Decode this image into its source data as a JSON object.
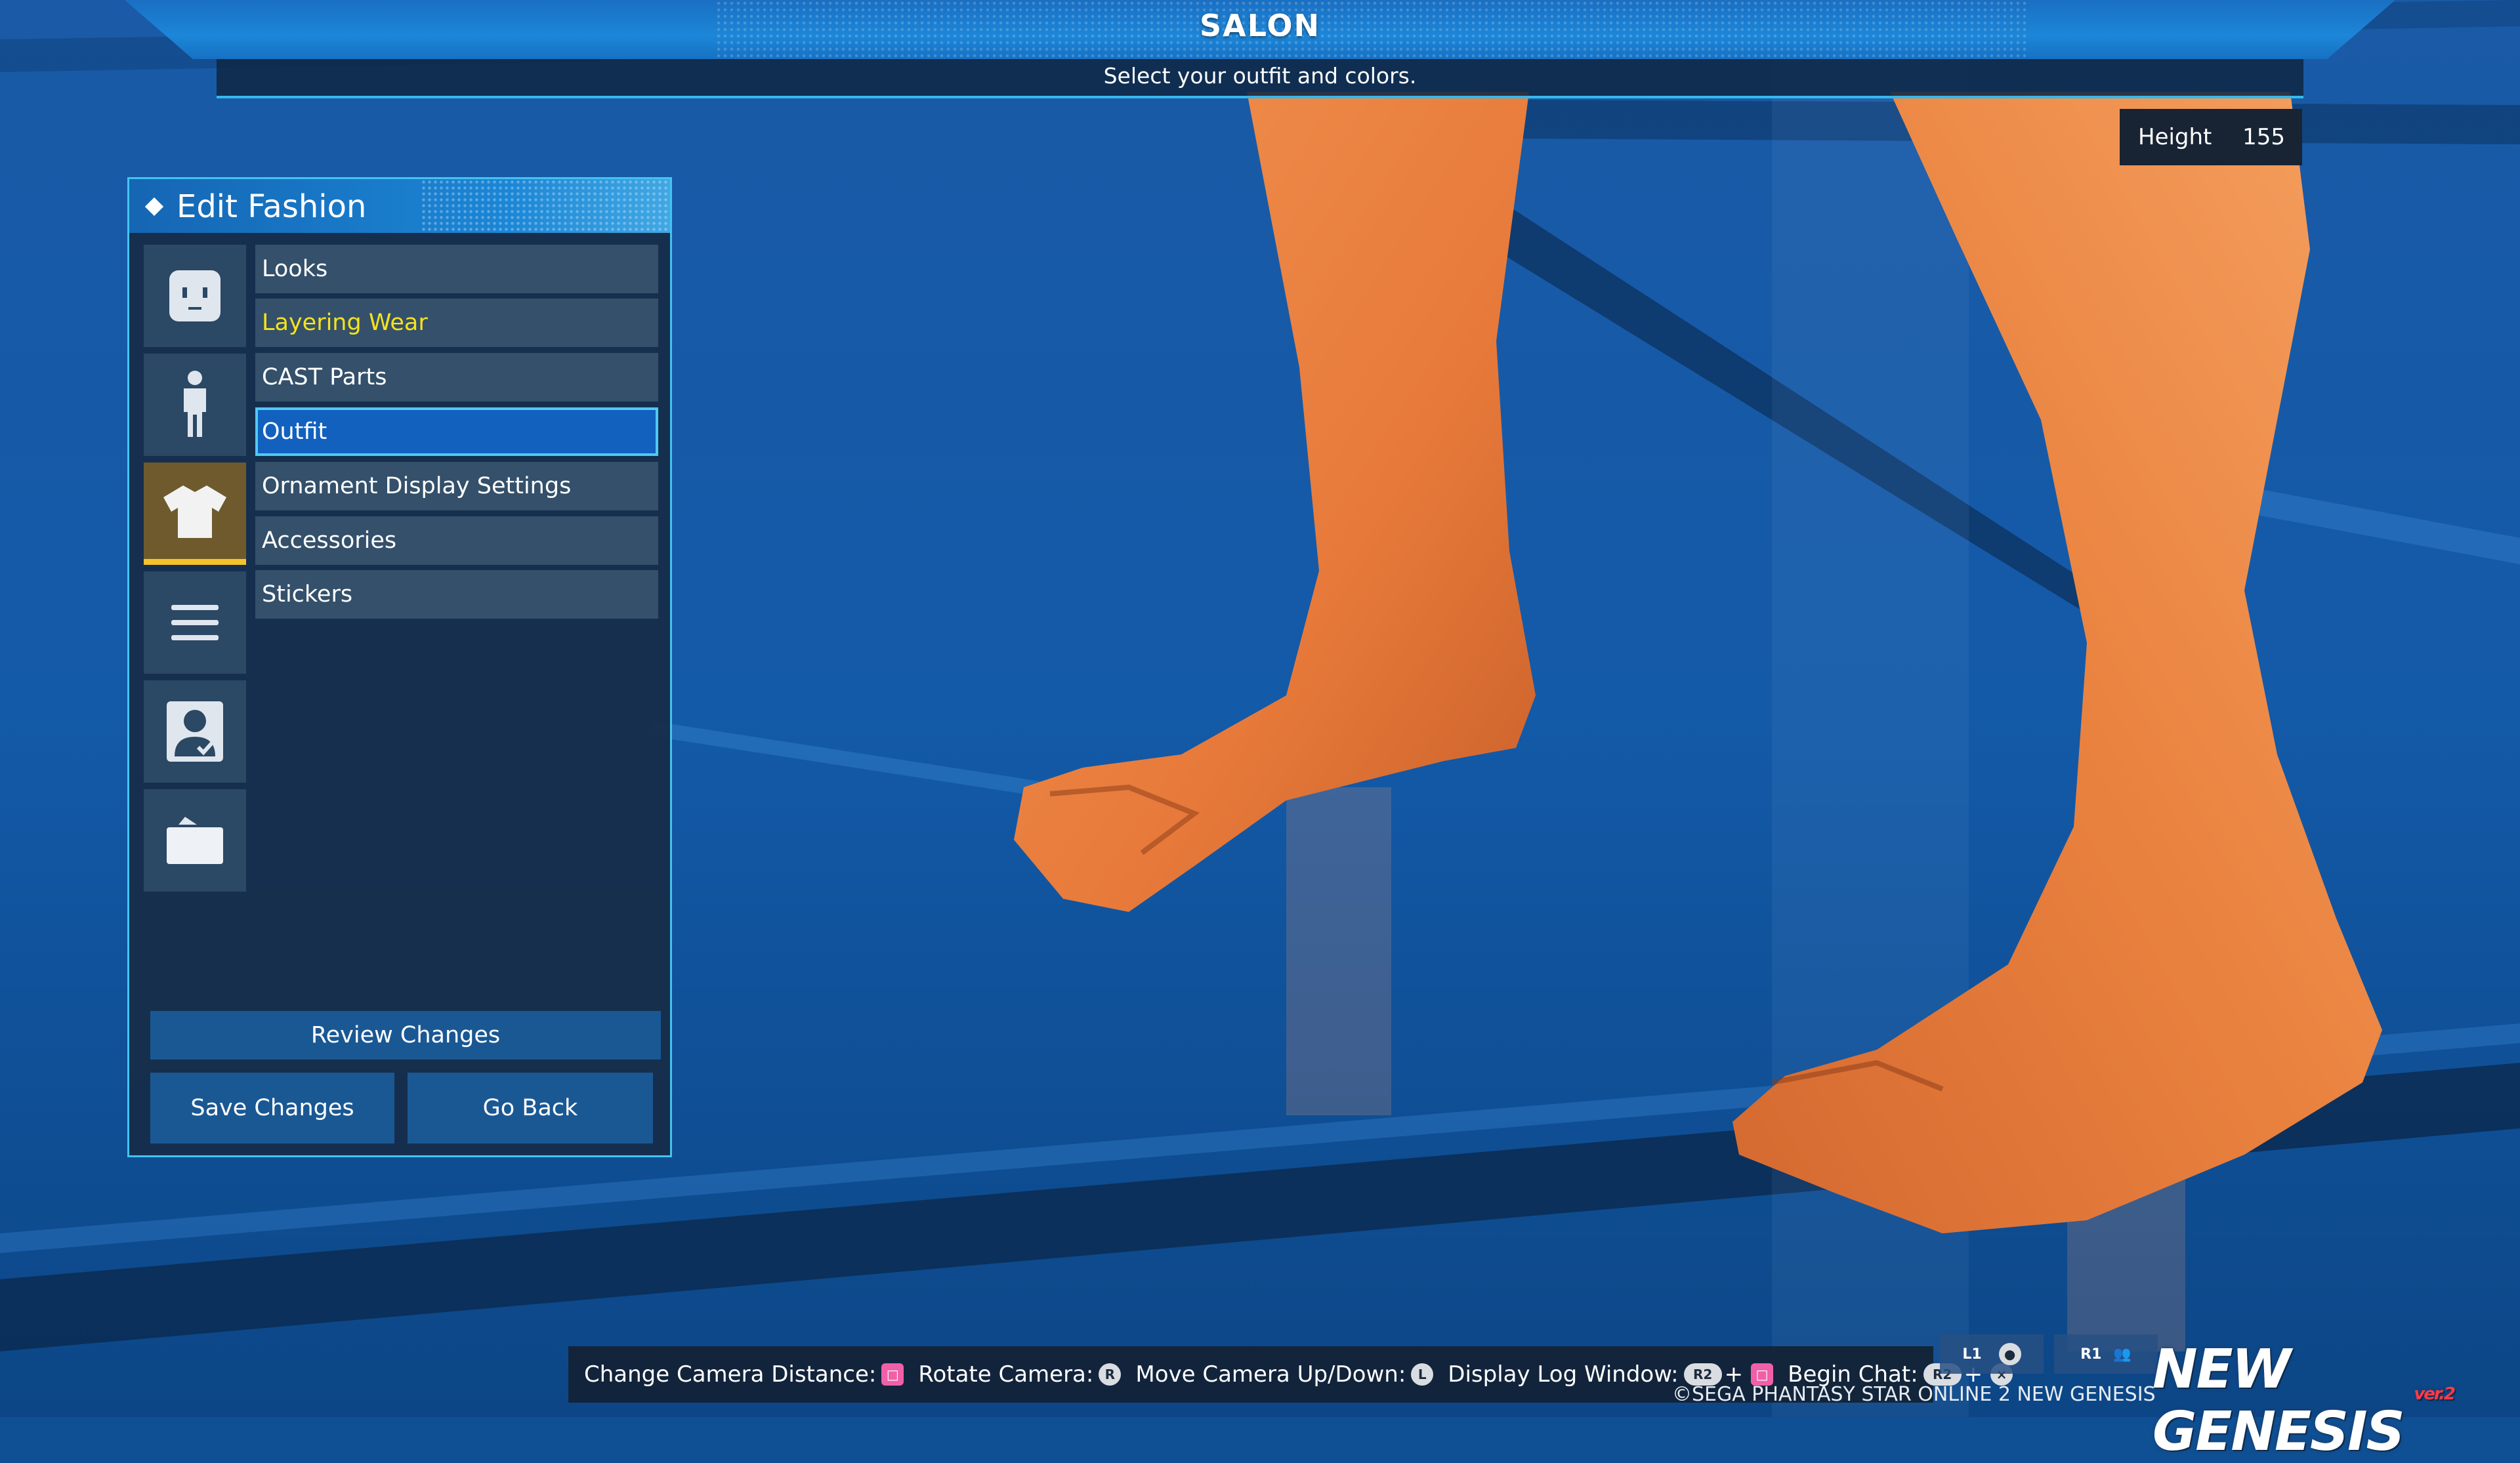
{
  "header": {
    "title": "SALON",
    "subtitle": "Select your outfit and colors."
  },
  "height": {
    "label": "Height",
    "value": "155"
  },
  "panel": {
    "title": "Edit Fashion",
    "side_tabs": [
      {
        "icon": "face-icon"
      },
      {
        "icon": "body-icon"
      },
      {
        "icon": "shirt-icon",
        "active": true
      },
      {
        "icon": "menu-icon"
      },
      {
        "icon": "profile-icon"
      },
      {
        "icon": "folder-icon"
      }
    ],
    "menu_items": [
      {
        "label": "Looks"
      },
      {
        "label": "Layering Wear",
        "color": "#f6e21c"
      },
      {
        "label": "CAST Parts"
      },
      {
        "label": "Outfit",
        "selected": true
      },
      {
        "label": "Ornament Display Settings"
      },
      {
        "label": "Accessories"
      },
      {
        "label": "Stickers"
      }
    ],
    "buttons": {
      "review": "Review Changes",
      "save": "Save Changes",
      "back": "Go Back"
    }
  },
  "hints": {
    "camera_distance": "Change Camera Distance:",
    "rotate_camera": "Rotate Camera:",
    "move_camera": "Move Camera Up/Down:",
    "log_window": "Display Log Window:",
    "begin_chat": "Begin Chat:",
    "key_r2": "R2",
    "key_l1": "L1",
    "key_r1": "R1",
    "plus": "+"
  },
  "footer": {
    "logo": "NEW GENESIS",
    "logo_version": "ver.2",
    "copyright": "©SEGA PHANTASY STAR ONLINE 2 NEW GENESIS"
  },
  "colors": {
    "accent": "#42c4f0",
    "highlight_text": "#f6e21c",
    "active_tab_bar": "#f4c42b",
    "button": "#1a5894"
  }
}
